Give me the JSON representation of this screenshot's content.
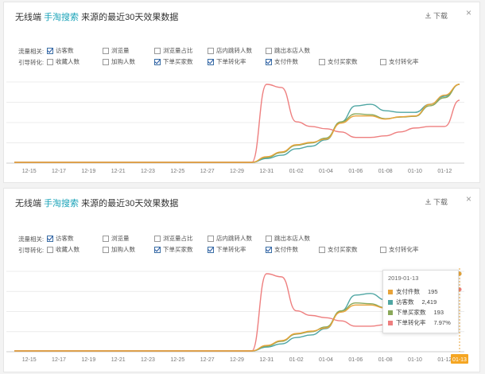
{
  "panel1": {
    "title_prefix": "无线端",
    "title_source": "手淘搜索",
    "title_suffix": "来源的最近30天效果数据",
    "download_label": "下载",
    "close_label": "×",
    "filter_groups": [
      {
        "label": "流量相关:",
        "options": [
          {
            "label": "访客数",
            "checked": true
          },
          {
            "label": "浏览量",
            "checked": false
          },
          {
            "label": "浏览量占比",
            "checked": false
          },
          {
            "label": "店内跳转人数",
            "checked": false
          },
          {
            "label": "跳出本店人数",
            "checked": false
          }
        ]
      },
      {
        "label": "引导转化:",
        "options": [
          {
            "label": "收藏人数",
            "checked": false
          },
          {
            "label": "加购人数",
            "checked": false
          },
          {
            "label": "下单买家数",
            "checked": true
          },
          {
            "label": "下单转化率",
            "checked": true
          },
          {
            "label": "支付件数",
            "checked": true
          },
          {
            "label": "支付买家数",
            "checked": false
          },
          {
            "label": "支付转化率",
            "checked": false
          }
        ]
      }
    ]
  },
  "panel2": {
    "title_prefix": "无线端",
    "title_source": "手淘搜索",
    "title_suffix": "来源的最近30天效果数据",
    "download_label": "下载",
    "close_label": "×",
    "filter_groups": [
      {
        "label": "流量相关:",
        "options": [
          {
            "label": "访客数",
            "checked": true
          },
          {
            "label": "浏览量",
            "checked": false
          },
          {
            "label": "浏览量占比",
            "checked": false
          },
          {
            "label": "店内跳转人数",
            "checked": false
          },
          {
            "label": "跳出本店人数",
            "checked": false
          }
        ]
      },
      {
        "label": "引导转化:",
        "options": [
          {
            "label": "收藏人数",
            "checked": false
          },
          {
            "label": "加购人数",
            "checked": false
          },
          {
            "label": "下单买家数",
            "checked": true
          },
          {
            "label": "下单转化率",
            "checked": true
          },
          {
            "label": "支付件数",
            "checked": true
          },
          {
            "label": "支付买家数",
            "checked": false
          },
          {
            "label": "支付转化率",
            "checked": false
          }
        ]
      }
    ],
    "tooltip": {
      "date": "2019-01-13",
      "rows": [
        {
          "name": "支付件数",
          "value": "195",
          "color": "#e8a33a"
        },
        {
          "name": "访客数",
          "value": "2,419",
          "color": "#4fa6a3"
        },
        {
          "name": "下单买家数",
          "value": "193",
          "color": "#8aa85a"
        },
        {
          "name": "下单转化率",
          "value": "7.97%",
          "color": "#ee7f7f"
        }
      ]
    },
    "axis_highlight": "01-13"
  },
  "chart_data": {
    "type": "line",
    "x": [
      "12-14",
      "12-15",
      "12-16",
      "12-17",
      "12-18",
      "12-19",
      "12-20",
      "12-21",
      "12-22",
      "12-23",
      "12-24",
      "12-25",
      "12-26",
      "12-27",
      "12-28",
      "12-29",
      "12-30",
      "12-31",
      "01-01",
      "01-02",
      "01-03",
      "01-04",
      "01-05",
      "01-06",
      "01-07",
      "01-08",
      "01-09",
      "01-10",
      "01-11",
      "01-12",
      "01-13"
    ],
    "x_tick_labels": [
      "12-15",
      "12-17",
      "12-19",
      "12-21",
      "12-23",
      "12-25",
      "12-27",
      "12-29",
      "12-31",
      "01-02",
      "01-04",
      "01-06",
      "01-08",
      "01-10",
      "01-12"
    ],
    "series": [
      {
        "name": "访客数",
        "color": "#4fa6a3",
        "values": [
          0,
          0,
          0,
          0,
          0,
          0,
          0,
          0,
          0,
          0,
          0,
          0,
          0,
          0,
          0,
          0,
          0,
          120,
          220,
          420,
          500,
          700,
          1250,
          1750,
          1800,
          1600,
          1550,
          1550,
          1800,
          2050,
          2419
        ]
      },
      {
        "name": "下单买家数",
        "color": "#8aa85a",
        "values": [
          0,
          0,
          0,
          0,
          0,
          0,
          0,
          0,
          0,
          0,
          0,
          0,
          0,
          0,
          0,
          0,
          0,
          12,
          24,
          42,
          48,
          60,
          100,
          120,
          118,
          108,
          112,
          114,
          140,
          160,
          193
        ]
      },
      {
        "name": "下单转化率",
        "color": "#ee7f7f",
        "values": [
          0,
          0,
          0,
          0,
          0,
          0,
          0,
          0,
          0,
          0,
          0,
          0,
          0,
          0,
          0,
          0,
          0,
          10.0,
          9.6,
          5.2,
          4.6,
          4.3,
          3.9,
          3.2,
          3.2,
          3.4,
          3.9,
          4.4,
          4.6,
          4.6,
          7.97
        ]
      },
      {
        "name": "支付件数",
        "color": "#e8a33a",
        "values": [
          0,
          0,
          0,
          0,
          0,
          0,
          0,
          0,
          0,
          0,
          0,
          0,
          0,
          0,
          0,
          0,
          0,
          14,
          26,
          44,
          50,
          58,
          98,
          116,
          116,
          108,
          114,
          116,
          145,
          168,
          195
        ]
      }
    ]
  }
}
